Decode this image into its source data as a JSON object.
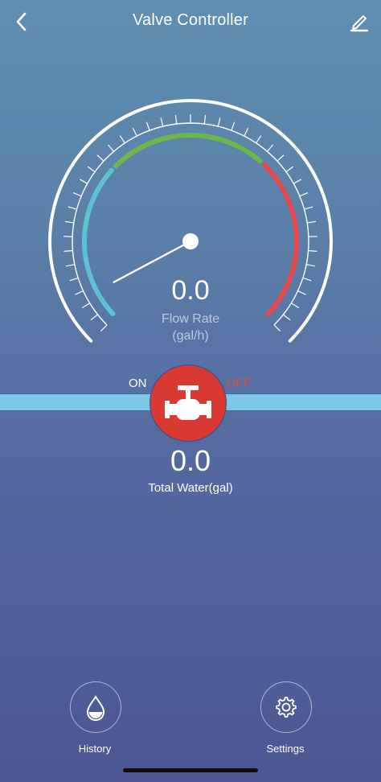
{
  "header": {
    "title": "Valve Controller",
    "back_icon": "chevron-left-icon",
    "edit_icon": "pencil-icon"
  },
  "gauge": {
    "value": "0.0",
    "label_line1": "Flow Rate",
    "label_line2": "(gal/h)",
    "needle_fraction": 0.0,
    "zones": {
      "low_color": "#5fc0d2",
      "mid_color": "#6cb84a",
      "high_color": "#e5484d"
    }
  },
  "valve": {
    "on_label": "ON",
    "off_label": "OFF",
    "state": "off",
    "icon": "valve-icon",
    "color": "#d93a33"
  },
  "total": {
    "value": "0.0",
    "label": "Total Water(gal)"
  },
  "nav": {
    "history_label": "History",
    "history_icon": "water-drop-icon",
    "settings_label": "Settings",
    "settings_icon": "gear-icon"
  },
  "colors": {
    "pipe": "#7cc7e6",
    "off_text": "#e24a3e"
  }
}
